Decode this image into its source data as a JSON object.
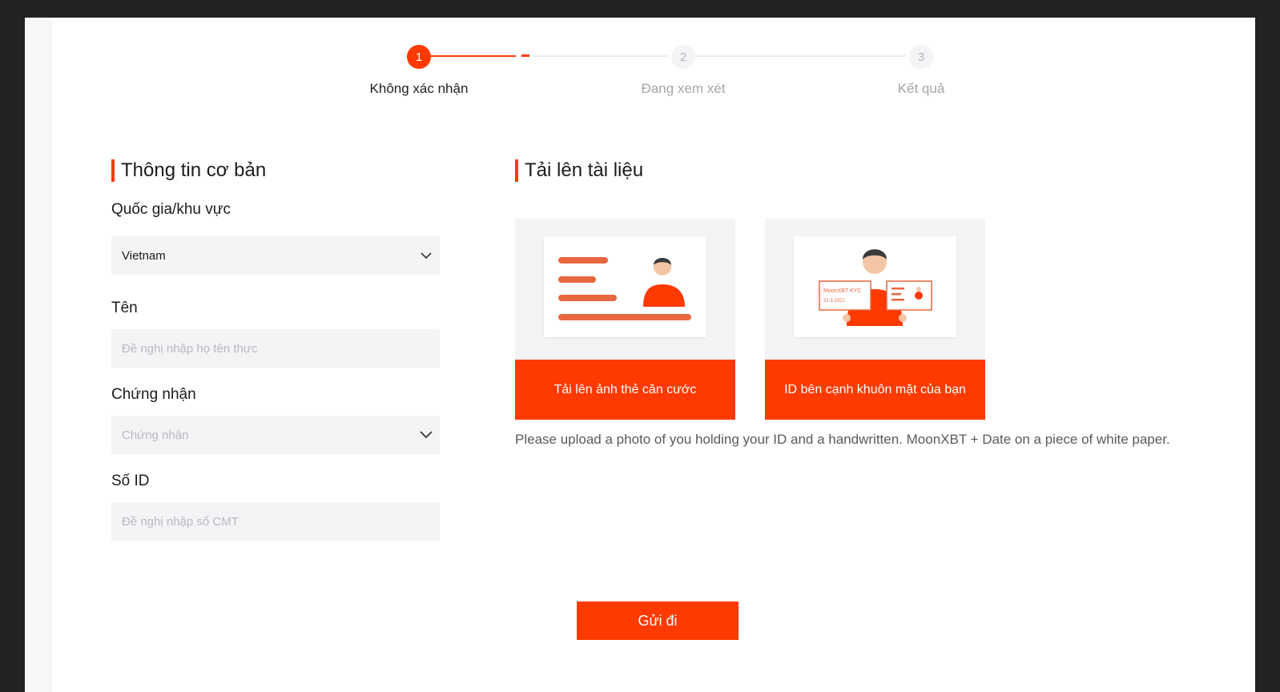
{
  "stepper": {
    "steps": [
      {
        "number": "1",
        "label": "Không xác nhận",
        "state": "active"
      },
      {
        "number": "2",
        "label": "Đang xem xét",
        "state": "pending"
      },
      {
        "number": "3",
        "label": "Kết quả",
        "state": "pending"
      }
    ]
  },
  "basic_info": {
    "title": "Thông tin cơ bản",
    "country": {
      "label": "Quốc gia/khu vực",
      "value": "Vietnam",
      "icon": "chevron-down-icon"
    },
    "name": {
      "label": "Tên",
      "placeholder": "Đề nghị nhập họ tên thực"
    },
    "certificate": {
      "label": "Chứng nhận",
      "placeholder": "Chứng nhận",
      "icon": "chevron-down-icon"
    },
    "id_number": {
      "label": "Số ID",
      "placeholder": "Đề nghị nhập số CMT"
    }
  },
  "upload": {
    "title": "Tải lên tài liệu",
    "cards": [
      {
        "button_label": "Tải lên ảnh thẻ căn cước",
        "illustration": "id-card-illustration"
      },
      {
        "button_label": "ID bên cạnh khuôn mặt của bạn",
        "illustration": "selfie-with-id-illustration",
        "illustration_text": [
          "MoonXBT KYC",
          "31.3.2021"
        ]
      }
    ],
    "note": "Please upload a photo of you holding your ID and a handwritten. MoonXBT + Date on a piece of white paper."
  },
  "submit": {
    "label": "Gửi đi"
  },
  "colors": {
    "accent": "#ff3a00",
    "field_bg": "#f4f4f6",
    "frame": "#232323"
  }
}
